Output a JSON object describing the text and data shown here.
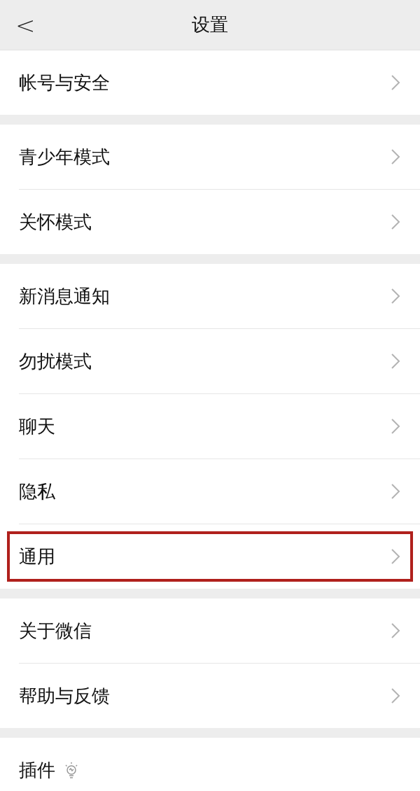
{
  "header": {
    "back": "<",
    "title": "设置"
  },
  "groups": [
    {
      "items": [
        {
          "label": "帐号与安全",
          "chevron": true,
          "highlighted": false
        }
      ]
    },
    {
      "items": [
        {
          "label": "青少年模式",
          "chevron": true,
          "highlighted": false
        },
        {
          "label": "关怀模式",
          "chevron": true,
          "highlighted": false
        }
      ]
    },
    {
      "items": [
        {
          "label": "新消息通知",
          "chevron": true,
          "highlighted": false
        },
        {
          "label": "勿扰模式",
          "chevron": true,
          "highlighted": false
        },
        {
          "label": "聊天",
          "chevron": true,
          "highlighted": false
        },
        {
          "label": "隐私",
          "chevron": true,
          "highlighted": false
        },
        {
          "label": "通用",
          "chevron": true,
          "highlighted": true
        }
      ]
    },
    {
      "items": [
        {
          "label": "关于微信",
          "chevron": true,
          "highlighted": false
        },
        {
          "label": "帮助与反馈",
          "chevron": true,
          "highlighted": false
        }
      ]
    },
    {
      "items": [
        {
          "label": "插件",
          "chevron": false,
          "highlighted": false,
          "bulb": true
        }
      ]
    }
  ]
}
